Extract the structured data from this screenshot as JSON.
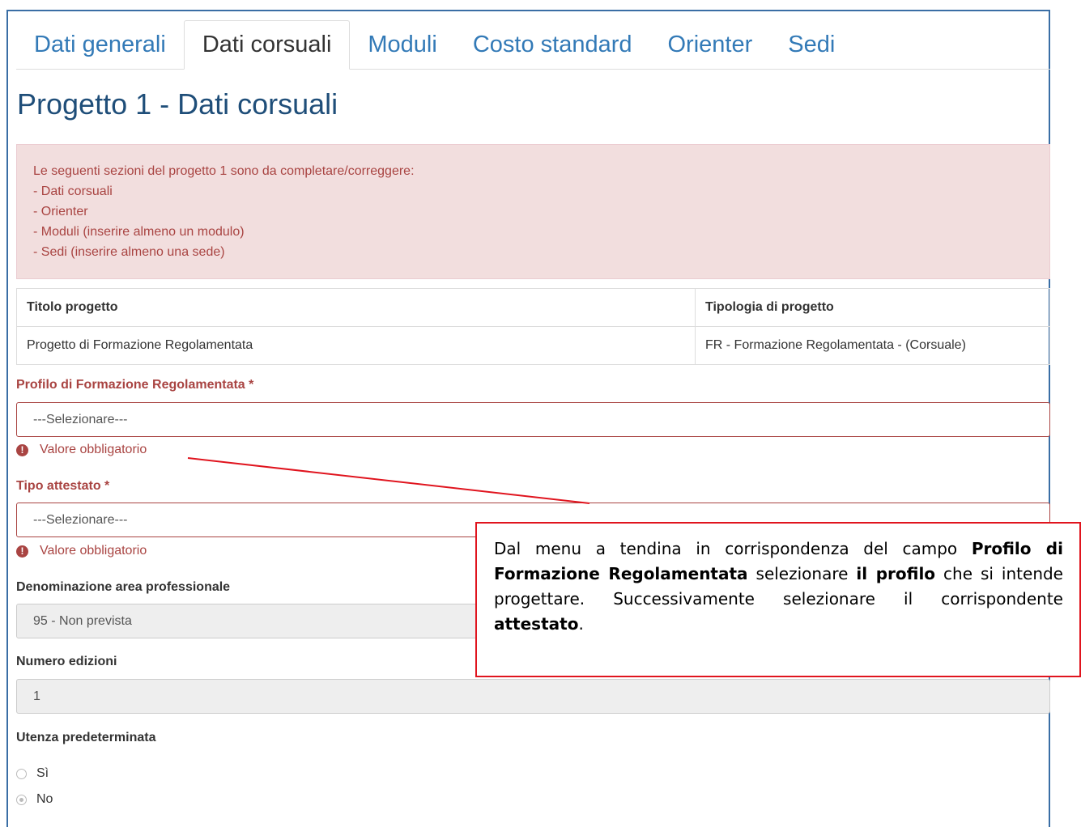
{
  "tabs": [
    {
      "label": "Dati generali",
      "active": false
    },
    {
      "label": "Dati corsuali",
      "active": true
    },
    {
      "label": "Moduli",
      "active": false
    },
    {
      "label": "Costo standard",
      "active": false
    },
    {
      "label": "Orienter",
      "active": false
    },
    {
      "label": "Sedi",
      "active": false
    }
  ],
  "page_title": "Progetto 1 - Dati corsuali",
  "alert": {
    "lines": [
      "Le seguenti sezioni del progetto 1 sono da completare/correggere:",
      "- Dati corsuali",
      "- Orienter",
      "- Moduli (inserire almeno un modulo)",
      "- Sedi (inserire almeno una sede)"
    ]
  },
  "info_table": {
    "headers": [
      "Titolo progetto",
      "Tipologia di progetto"
    ],
    "row": [
      "Progetto di Formazione Regolamentata",
      "FR - Formazione Regolamentata - (Corsuale)"
    ]
  },
  "form": {
    "profilo": {
      "label": "Profilo di Formazione Regolamentata *",
      "value": "---Selezionare---",
      "error": "Valore obbligatorio"
    },
    "attestato": {
      "label": "Tipo attestato *",
      "value": "---Selezionare---",
      "error": "Valore obbligatorio"
    },
    "area": {
      "label": "Denominazione area professionale",
      "value": "95 - Non prevista"
    },
    "edizioni": {
      "label": "Numero edizioni",
      "value": "1"
    },
    "utenza": {
      "label": "Utenza predeterminata",
      "options": [
        "Sì",
        "No"
      ],
      "selected": "No"
    }
  },
  "callout": {
    "t1": "Dal menu a tendina in corrispondenza del campo ",
    "b1": "Profilo di Formazione Regolamentata",
    "t2": " selezionare ",
    "b2": "il profilo",
    "t3": " che si intende progettare. Successivamente selezionare il corrispondente ",
    "b3": "attestato",
    "t4": "."
  },
  "colors": {
    "tab_link": "#337ab7",
    "title": "#1f4e79",
    "error": "#a94442",
    "alert_bg": "#f2dede",
    "callout_border": "#e0141e"
  }
}
